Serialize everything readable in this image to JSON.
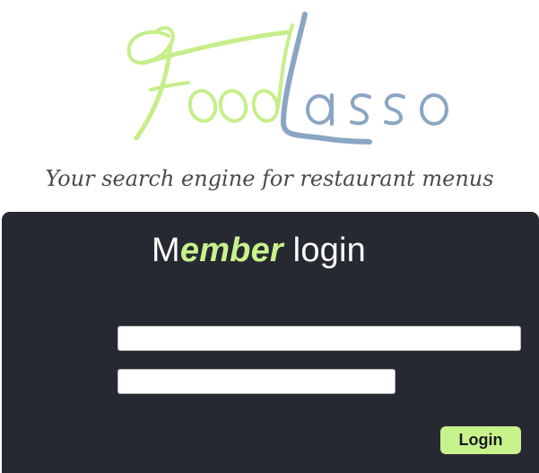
{
  "logo": {
    "part1": "Food",
    "part2": "Lasso",
    "color1": "#c6ee8a",
    "color2": "#8aa6c4"
  },
  "tagline": "Your search engine for restaurant menus",
  "login_panel": {
    "title_prefix": "M",
    "title_accent": "ember",
    "title_suffix": " login",
    "username": {
      "value": "",
      "placeholder": ""
    },
    "password": {
      "value": "",
      "placeholder": ""
    },
    "login_button_label": "Login"
  },
  "colors": {
    "panel_bg": "#272932",
    "accent": "#c7f28c",
    "tagline": "#4b4b4b"
  }
}
